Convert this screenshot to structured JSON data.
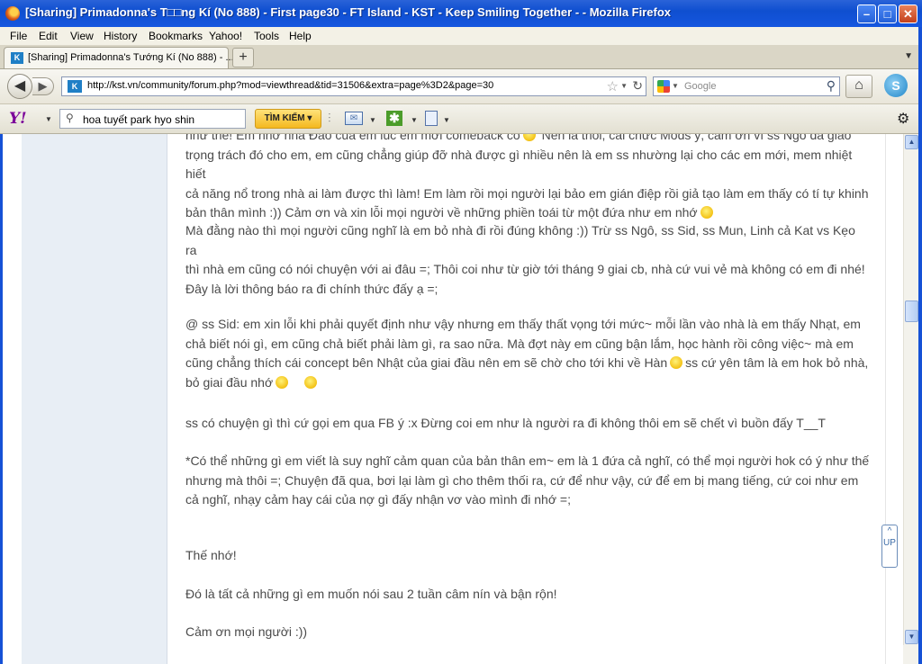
{
  "window": {
    "title": "[Sharing] Primadonna's T□□ng Kí (No 888) - First page30 - FT Island - KST - Keep Smiling Together - - Mozilla Firefox",
    "minimize": "–",
    "maximize": "□",
    "close": "✕"
  },
  "menu": [
    "File",
    "Edit",
    "View",
    "History",
    "Bookmarks",
    "Yahoo!",
    "Tools",
    "Help"
  ],
  "tab": {
    "label": "[Sharing] Primadonna's Tướng Kí (No 888) - ...",
    "new_tab": "+"
  },
  "nav": {
    "url": "http://kst.vn/community/forum.php?mod=viewthread&tid=31506&extra=page%3D2&page=30",
    "search_placeholder": "Google"
  },
  "yahoo": {
    "logo": "Y!",
    "search_value": "hoa tuyết park hyo shin",
    "search_button": "TÌM KIẾM"
  },
  "post": {
    "p1_line0": "như thế! Em nhớ nhà Đảo của em lúc em mới comeback có",
    "p1_line0b": "Nên là thôi, cái chức Mods ý, cảm ơn vì ss Ngô đã giao",
    "p1_line1": "trọng trách đó cho em, em cũng chẳng giúp đỡ nhà được gì nhiều nên là em ss nhường lại cho các em mới, mem nhiệt hiết",
    "p1_line2": "cả năng nổ trong nhà ai làm được thì làm! Em làm rồi mọi người lại bảo em gián điệp rồi giả tạo làm em thấy có tí tự khinh",
    "p1_line3": "bản thân mình :)) Cảm ơn và xin lỗi mọi người về những phiền toái từ một đứa như em nhớ",
    "p2_line1": "Mà đằng nào thì mọi người cũng nghĩ là em bỏ nhà đi rồi đúng không :)) Trừ ss Ngô, ss Sid, ss Mun, Linh cả Kat vs Kẹo ra",
    "p2_line2": "thì nhà em cũng có nói chuyện với ai đâu =; Thôi coi như từ giờ tới tháng 9 giai cb, nhà cứ vui vẻ mà không có em đi nhé!",
    "p2_line3": "Đây là lời thông báo ra đi chính thức đấy ạ =;",
    "p3_line1": "@ ss Sid: em xin lỗi khi phải quyết định như vậy nhưng em thấy thất vọng tới mức~ mỗi lần vào nhà là em thấy Nhạt, em",
    "p3_line2": "chả biết nói gì, em cũng chả biết phải làm gì, ra sao nữa. Mà đợt này em cũng bận lắm, học hành rồi công việc~ mà em",
    "p3_line3": "cũng chẳng thích cái concept bên Nhật của giai đầu nên em sẽ chờ cho tới khi về Hàn",
    "p3_line3b": "ss cứ yên tâm là em hok bỏ nhà,",
    "p3_line4": "bỏ giai đầu nhớ",
    "p4": "ss có chuyện gì thì cứ gọi em qua FB ý :x Đừng coi em như là người ra đi không thôi em sẽ chết vì buồn đấy T__T",
    "p5_line1": "*Có thể những gì em viết là suy nghĩ cảm quan của bản thân em~ em là 1 đứa cả nghĩ, có thể mọi người hok có ý như thế",
    "p5_line2": "nhưng mà thôi =; Chuyện đã qua, bơi lại làm gì cho thêm thối ra, cứ để như vậy, cứ để em bị mang tiếng, cứ coi như em",
    "p5_line3": "cả nghĩ, nhạy cảm hay cái của nợ gì đấy nhận vơ vào mình đi nhớ =;",
    "p6": "Thế nhớ!",
    "p7": "Đó là tất cả những gì em muốn nói sau 2 tuần câm nín và bận rộn!",
    "p8": "Cảm ơn mọi người :))"
  },
  "sidetab": {
    "up": "^",
    "label": "UP"
  },
  "colors": {
    "text": "#4a4a4a",
    "leftcol": "#e8eef5",
    "titlebar": "#1556df"
  }
}
